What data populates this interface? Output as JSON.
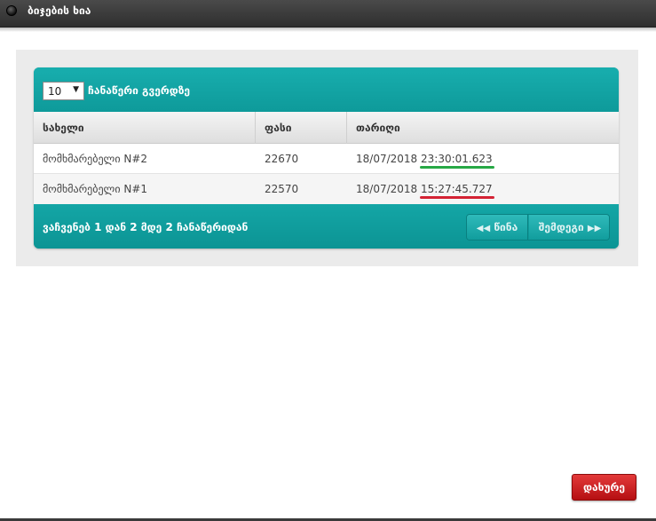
{
  "window": {
    "title": "ბიჯების ხია"
  },
  "length_menu": {
    "value": "10",
    "label": "ჩანაწერი გვერდზე"
  },
  "table": {
    "columns": [
      "სახელი",
      "ფასი",
      "თარიღი"
    ],
    "rows": [
      {
        "name": "მომხმარებელი N#2",
        "price": "22670",
        "date": "18/07/2018",
        "time": "23:30:01.623"
      },
      {
        "name": "მომხმარებელი N#1",
        "price": "22570",
        "date": "18/07/2018",
        "time": "15:27:45.727"
      }
    ]
  },
  "footer": {
    "info": "ვაჩვენებ 1 დან 2 მდე 2 ჩანაწერიდან",
    "prev_label": "წინა",
    "next_label": "შემდეგი"
  },
  "close_label": "დახურე",
  "colors": {
    "accent_teal": "#12a1a1",
    "close_red": "#c8181b",
    "newest_underline": "#27a845",
    "older_underline": "#d42234"
  }
}
